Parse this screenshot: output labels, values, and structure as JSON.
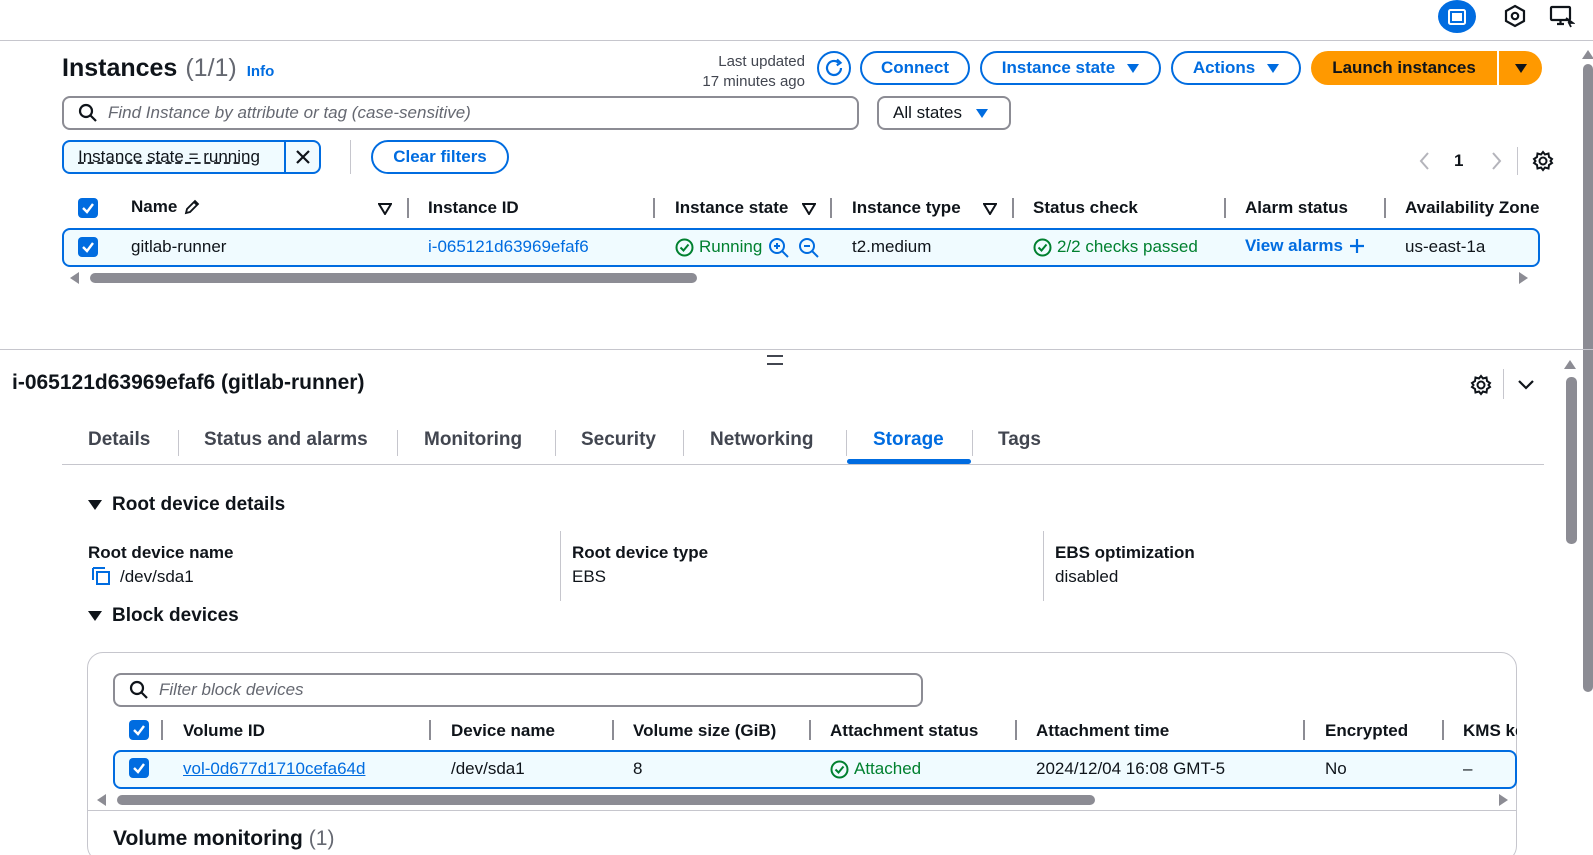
{
  "colors": {
    "accent": "#006ce0",
    "primary_button": "#ff9900",
    "success": "#00802f"
  },
  "topbar": {
    "icons": [
      "panel-layout-icon",
      "settings-hex-icon",
      "remote-desktop-icon"
    ]
  },
  "instances": {
    "title": "Instances",
    "count": "(1/1)",
    "info_label": "Info",
    "last_updated_line1": "Last updated",
    "last_updated_line2": "17 minutes ago",
    "connect_label": "Connect",
    "instance_state_label": "Instance state",
    "actions_label": "Actions",
    "launch_label": "Launch instances",
    "search_placeholder": "Find Instance by attribute or tag (case-sensitive)",
    "states_select": "All states",
    "filter_token": "Instance state = running",
    "clear_filters": "Clear filters",
    "page_number": "1",
    "columns": {
      "name": "Name",
      "instance_id": "Instance ID",
      "instance_state": "Instance state",
      "instance_type": "Instance type",
      "status_check": "Status check",
      "alarm_status": "Alarm status",
      "availability_zone": "Availability Zone"
    },
    "row": {
      "name": "gitlab-runner",
      "instance_id": "i-065121d63969efaf6",
      "instance_state": "Running",
      "instance_type": "t2.medium",
      "status_check": "2/2 checks passed",
      "alarm_status": "View alarms",
      "availability_zone": "us-east-1a"
    }
  },
  "details": {
    "title": "i-065121d63969efaf6 (gitlab-runner)",
    "tabs": [
      "Details",
      "Status and alarms",
      "Monitoring",
      "Security",
      "Networking",
      "Storage",
      "Tags"
    ],
    "active_tab": "Storage",
    "root_section": "Root device details",
    "root_device_name_label": "Root device name",
    "root_device_name": "/dev/sda1",
    "root_device_type_label": "Root device type",
    "root_device_type": "EBS",
    "ebs_opt_label": "EBS optimization",
    "ebs_opt": "disabled",
    "block_section": "Block devices",
    "block_filter_placeholder": "Filter block devices",
    "block_columns": {
      "volume_id": "Volume ID",
      "device_name": "Device name",
      "volume_size": "Volume size (GiB)",
      "attachment_status": "Attachment status",
      "attachment_time": "Attachment time",
      "encrypted": "Encrypted",
      "kms": "KMS key"
    },
    "block_row": {
      "volume_id": "vol-0d677d1710cefa64d",
      "device_name": "/dev/sda1",
      "volume_size": "8",
      "attachment_status": "Attached",
      "attachment_time": "2024/12/04 16:08 GMT-5",
      "encrypted": "No",
      "kms": "–"
    },
    "volume_monitoring": "Volume monitoring",
    "volume_monitoring_count": "(1)"
  }
}
